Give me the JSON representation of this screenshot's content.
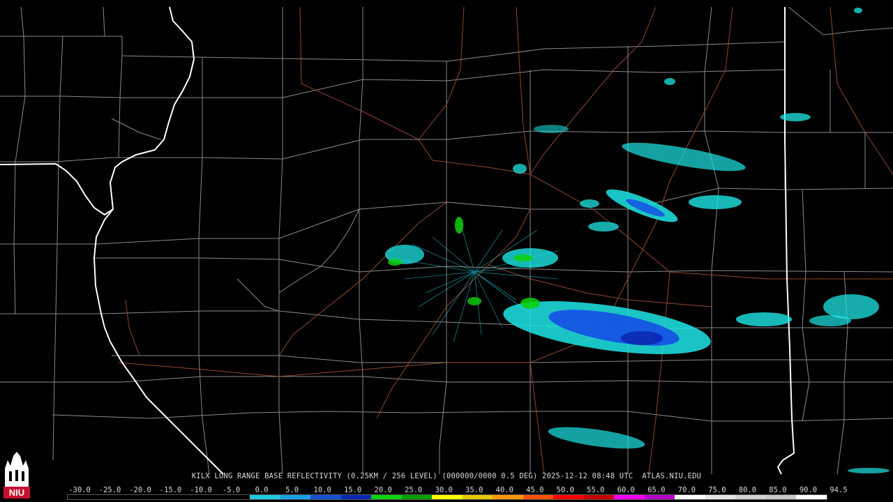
{
  "caption": "KILX LONG RANGE BASE REFLECTIVITY (0.25KM / 256 LEVEL) (000000/0000 0.5 DEG) 2025-12-12 08:48 UTC  ATLAS.NIU.EDU",
  "legend_labels": [
    "-30.0",
    "-25.0",
    "-20.0",
    "-15.0",
    "-10.0",
    "-5.0",
    "0.0",
    "5.0",
    "10.0",
    "15.0",
    "20.0",
    "25.0",
    "30.0",
    "35.0",
    "40.0",
    "45.0",
    "50.0",
    "55.0",
    "60.0",
    "65.0",
    "70.0",
    "75.0",
    "80.0",
    "85.0",
    "90.0",
    "94.5"
  ],
  "legend_colors": [
    "#000000",
    "#000000",
    "#000000",
    "#000000",
    "#000000",
    "#000000",
    "#1ec8dc",
    "#19a0e6",
    "#1450d2",
    "#0a28b4",
    "#0ad20a",
    "#06a000",
    "#ffff00",
    "#e6c800",
    "#ff9600",
    "#ff5000",
    "#ff0000",
    "#c80000",
    "#ff00ff",
    "#b400c8",
    "#ffffff",
    "#e6e6e6",
    "#d2d2d2",
    "#c8c8c8",
    "#ffffff"
  ],
  "logo_text": "NIU",
  "colors": {
    "background": "#000000",
    "county_lines": "#8a8a8a",
    "state_lines": "#ffffff",
    "roads": "#a0522d",
    "light_echo": "#1ee6e6",
    "moderate_echo": "#1450e6",
    "heavy_echo": "#0ad20a"
  }
}
